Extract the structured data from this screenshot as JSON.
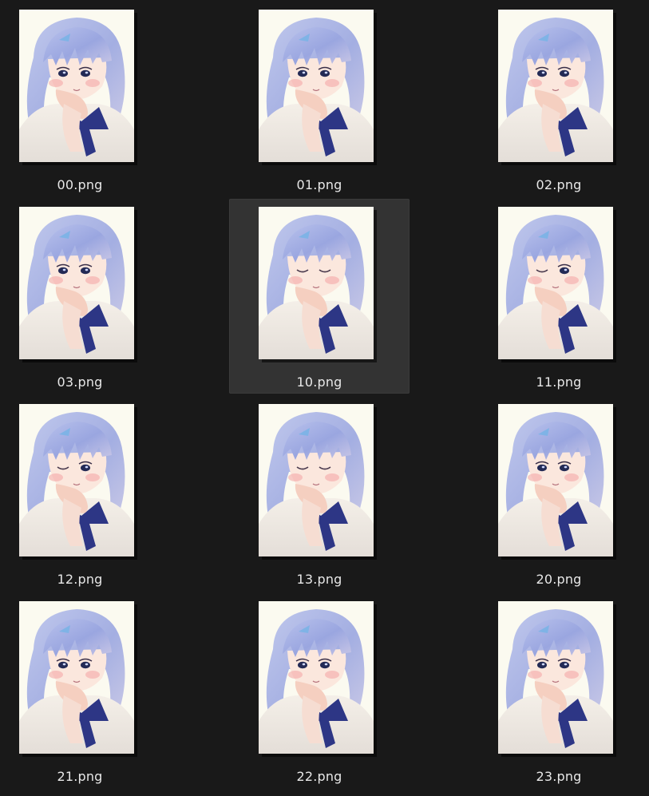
{
  "colors": {
    "background": "#191919",
    "selection": "#333333",
    "label_text": "#e8e8e8"
  },
  "thumbnail_subject": "anime-girl-illustration",
  "files": [
    {
      "name": "00.png",
      "eyes": "open",
      "selected": false
    },
    {
      "name": "01.png",
      "eyes": "open",
      "selected": false
    },
    {
      "name": "02.png",
      "eyes": "open",
      "selected": false
    },
    {
      "name": "03.png",
      "eyes": "open",
      "selected": false
    },
    {
      "name": "10.png",
      "eyes": "closed",
      "selected": true
    },
    {
      "name": "11.png",
      "eyes": "wink",
      "selected": false
    },
    {
      "name": "12.png",
      "eyes": "wink",
      "selected": false
    },
    {
      "name": "13.png",
      "eyes": "closed",
      "selected": false
    },
    {
      "name": "20.png",
      "eyes": "open",
      "selected": false
    },
    {
      "name": "21.png",
      "eyes": "open",
      "selected": false
    },
    {
      "name": "22.png",
      "eyes": "open",
      "selected": false
    },
    {
      "name": "23.png",
      "eyes": "open",
      "selected": false
    }
  ]
}
